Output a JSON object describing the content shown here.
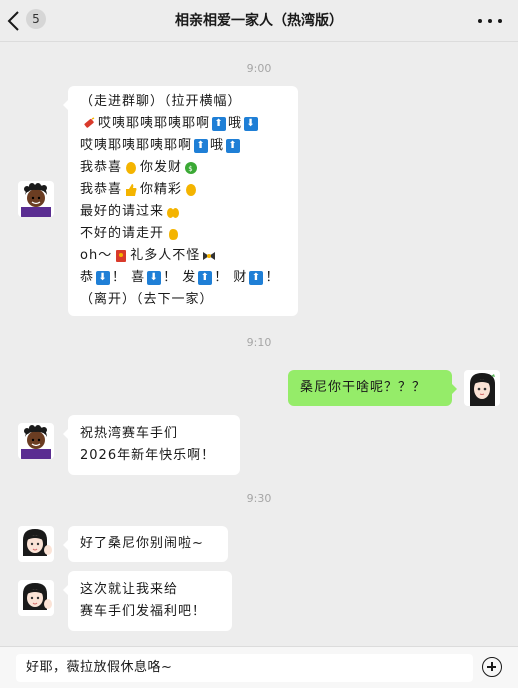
{
  "header": {
    "title": "相亲相爱一家人（热湾版）",
    "unread_count": "5",
    "back_icon": "chevron-left-icon",
    "more_icon": "more-dots-icon"
  },
  "messages": {
    "time1": "9:00",
    "m1": {
      "l1": "（走进群聊）（拉开横幅）",
      "l2a": "哎咦耶咦耶咦耶啊",
      "l2b": "哦",
      "l3a": "哎咦耶咦耶咦耶啊",
      "l3b": "哦",
      "l4a": "我恭喜",
      "l4b": "你发财",
      "l5a": "我恭喜",
      "l5b": "你精彩",
      "l6": "最好的请过来",
      "l7": "不好的请走开",
      "l8a": "oh～",
      "l8b": "礼多人不怪",
      "l9a": "恭",
      "l9b": "！ 喜",
      "l9c": "！ 发",
      "l9d": "！ 财",
      "l9e": "！",
      "l10": "（离开）（去下一家）"
    },
    "time2": "9:10",
    "m2": "桑尼你干啥呢？？？",
    "m3": {
      "l1": "祝热湾赛车手们",
      "l2": "2026年新年快乐啊！"
    },
    "time3": "9:30",
    "m4": "好了桑尼你别闹啦~",
    "m5": {
      "l1": "这次就让我来给",
      "l2": "赛车手们发福利吧！"
    }
  },
  "footer": {
    "input_value": "好耶，薇拉放假休息咯~",
    "plus_icon": "plus-circle-icon"
  },
  "colors": {
    "background": "#ededed",
    "self_bubble": "#95ec69",
    "other_bubble": "#ffffff",
    "arrow_emoji": "#1f7fd6"
  }
}
